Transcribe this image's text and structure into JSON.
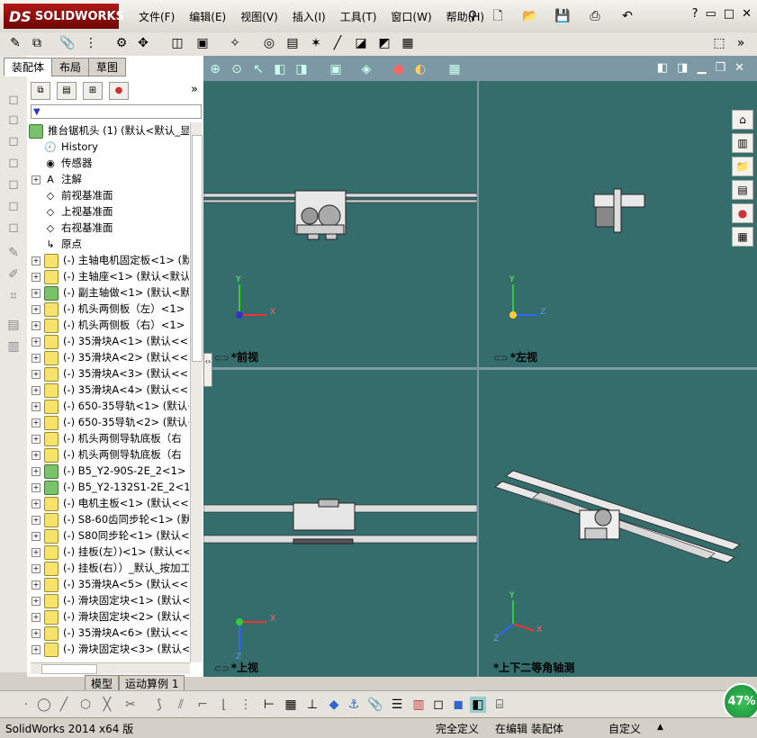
{
  "app": {
    "logo_prefix": "DS",
    "logo_text": "SOLIDWORKS"
  },
  "menu": [
    "文件(F)",
    "编辑(E)",
    "视图(V)",
    "插入(I)",
    "工具(T)",
    "窗口(W)",
    "帮助(H)"
  ],
  "window_controls": {
    "help": "?",
    "minimize": "▭",
    "restore": "□",
    "close": "✕"
  },
  "tabs": [
    {
      "label": "装配体",
      "active": true
    },
    {
      "label": "布局",
      "active": false
    },
    {
      "label": "草图",
      "active": false
    }
  ],
  "fm_more": "»",
  "tree": {
    "root": "推台锯机头 (1) (默认<默认_显",
    "items": [
      {
        "label": "History",
        "icon": "history-icon",
        "expand": false
      },
      {
        "label": "传感器",
        "icon": "sensor-icon",
        "expand": false
      },
      {
        "label": "注解",
        "icon": "annotation-icon",
        "expand": true
      },
      {
        "label": "前视基准面",
        "icon": "plane-icon",
        "expand": false
      },
      {
        "label": "上视基准面",
        "icon": "plane-icon",
        "expand": false
      },
      {
        "label": "右视基准面",
        "icon": "plane-icon",
        "expand": false
      },
      {
        "label": "原点",
        "icon": "origin-icon",
        "expand": false
      },
      {
        "label": "(-) 主轴电机固定板<1> (默",
        "icon": "part-icon",
        "expand": true
      },
      {
        "label": "(-) 主轴座<1> (默认<默认",
        "icon": "part-icon",
        "expand": true
      },
      {
        "label": "(-) 副主轴做<1> (默认<默",
        "icon": "assembly-icon",
        "expand": true
      },
      {
        "label": "(-) 机头两侧板（左）<1> (",
        "icon": "part-icon",
        "expand": true
      },
      {
        "label": "(-) 机头两侧板（右）<1> (",
        "icon": "part-icon",
        "expand": true
      },
      {
        "label": "(-) 35滑块A<1> (默认<<默",
        "icon": "part-icon",
        "expand": true
      },
      {
        "label": "(-) 35滑块A<2> (默认<<默",
        "icon": "part-icon",
        "expand": true
      },
      {
        "label": "(-) 35滑块A<3> (默认<<默",
        "icon": "part-icon",
        "expand": true
      },
      {
        "label": "(-) 35滑块A<4> (默认<<默",
        "icon": "part-icon",
        "expand": true
      },
      {
        "label": "(-) 650-35导轨<1> (默认<<",
        "icon": "part-icon",
        "expand": true
      },
      {
        "label": "(-) 650-35导轨<2> (默认<<",
        "icon": "part-icon",
        "expand": true
      },
      {
        "label": "(-) 机头两侧导轨底板（右",
        "icon": "part-icon",
        "expand": true
      },
      {
        "label": "(-) 机头两侧导轨底板（右",
        "icon": "part-icon",
        "expand": true
      },
      {
        "label": "(-) B5_Y2-90S-2E_2<1> (默",
        "icon": "assembly-icon",
        "expand": true
      },
      {
        "label": "(-) B5_Y2-132S1-2E_2<1> (",
        "icon": "assembly-icon",
        "expand": true
      },
      {
        "label": "(-) 电机主板<1> (默认<<默",
        "icon": "part-icon",
        "expand": true
      },
      {
        "label": "(-) S8-60齿同步轮<1> (默认",
        "icon": "part-icon",
        "expand": true
      },
      {
        "label": "(-) S80同步轮<1> (默认<<",
        "icon": "part-icon",
        "expand": true
      },
      {
        "label": "(-) 挂板(左）)<1> (默认<<",
        "icon": "part-icon",
        "expand": true
      },
      {
        "label": "(-) 挂板(右））_默认_按加工",
        "icon": "part-icon",
        "expand": true
      },
      {
        "label": "(-) 35滑块A<5> (默认<<默",
        "icon": "part-icon",
        "expand": true
      },
      {
        "label": "(-) 滑块固定块<1> (默认<<",
        "icon": "part-icon",
        "expand": true
      },
      {
        "label": "(-) 滑块固定块<2> (默认<<",
        "icon": "part-icon",
        "expand": true
      },
      {
        "label": "(-) 35滑块A<6> (默认<<默",
        "icon": "part-icon",
        "expand": true
      },
      {
        "label": "(-) 滑块固定块<3> (默认<<",
        "icon": "part-icon",
        "expand": true
      }
    ]
  },
  "bottom_tabs": [
    {
      "label": "模型",
      "active": true
    },
    {
      "label": "运动算例 1",
      "active": false
    }
  ],
  "viewports": {
    "front": "*前视",
    "left": "*左视",
    "top": "*上视",
    "iso": "*上下二等角轴测"
  },
  "axes": {
    "x": "X",
    "y": "Y",
    "z": "Z"
  },
  "status": {
    "version": "SolidWorks 2014 x64 版",
    "defined": "完全定义",
    "editing": "在编辑 装配体",
    "custom": "自定义",
    "caret": "▲"
  },
  "badge_percent": "47%",
  "colors": {
    "viewport_bg": "#356d6d",
    "logo_red": "#b01818"
  }
}
